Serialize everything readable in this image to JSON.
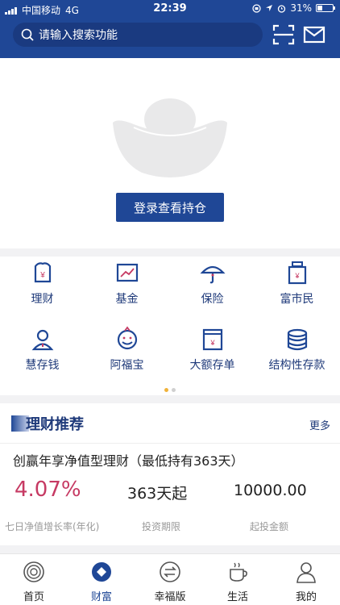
{
  "status": {
    "carrier": "中国移动",
    "network": "4G",
    "time": "22:39",
    "battery": "31%",
    "battery_level": 0.31
  },
  "header": {
    "search_placeholder": "请输入搜索功能",
    "icons": [
      "search-icon",
      "scan-icon",
      "mail-icon"
    ]
  },
  "hero": {
    "login_label": "登录查看持仓",
    "icon": "ingot-icon"
  },
  "grid": {
    "items": [
      {
        "label": "理财",
        "icon": "wealth-icon"
      },
      {
        "label": "基金",
        "icon": "fund-chart-icon"
      },
      {
        "label": "保险",
        "icon": "umbrella-icon"
      },
      {
        "label": "富市民",
        "icon": "citizen-icon"
      },
      {
        "label": "慧存钱",
        "icon": "person-icon"
      },
      {
        "label": "阿福宝",
        "icon": "smile-icon"
      },
      {
        "label": "大额存单",
        "icon": "certificate-icon"
      },
      {
        "label": "结构性存款",
        "icon": "coin-stack-icon"
      }
    ],
    "active_page": 0,
    "page_count": 2
  },
  "recommend": {
    "title": "理财推荐",
    "more_label": "更多",
    "product_name": "创赢年享净值型理财（最低持有363天）",
    "rate": "4.07%",
    "period": "363天起",
    "min_amount": "10000.00",
    "rate_label": "七日净值增长率(年化)",
    "period_label": "投资期限",
    "amount_label": "起投金额"
  },
  "colors": {
    "brand": "#1f4796",
    "rate": "#c63a63",
    "dot_active": "#f0b23a"
  },
  "tabs": [
    {
      "label": "首页",
      "icon": "home-icon"
    },
    {
      "label": "财富",
      "icon": "wealth-diamond-icon"
    },
    {
      "label": "幸福版",
      "icon": "exchange-icon"
    },
    {
      "label": "生活",
      "icon": "coffee-icon"
    },
    {
      "label": "我的",
      "icon": "profile-icon"
    }
  ]
}
